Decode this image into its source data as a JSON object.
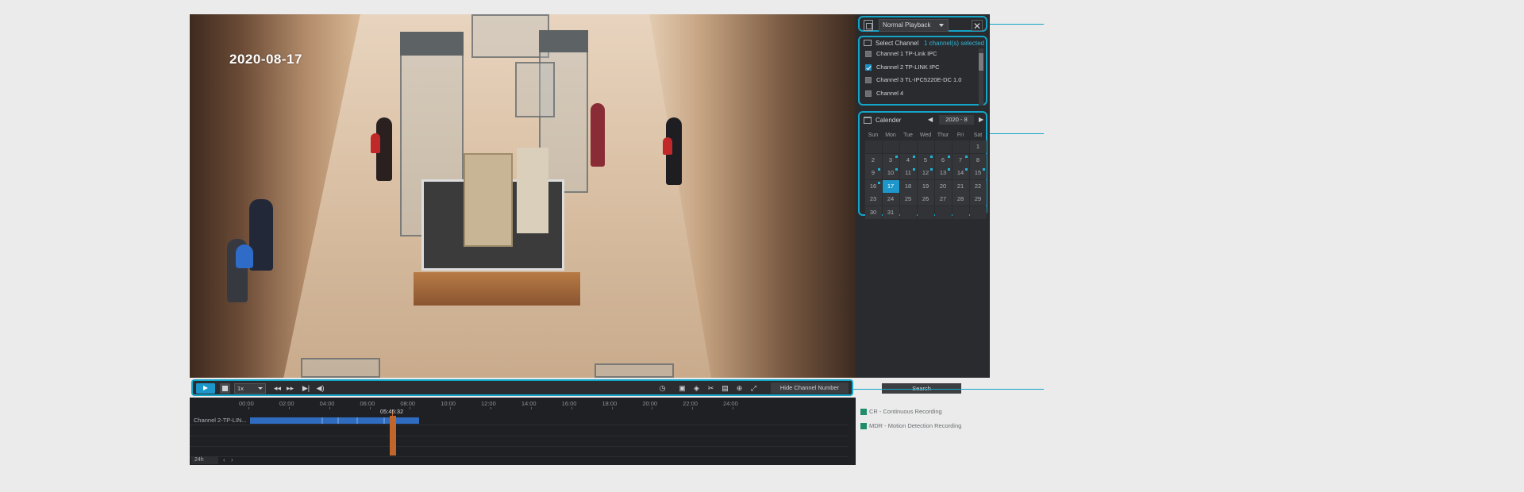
{
  "video": {
    "timestamp": "2020-08-17"
  },
  "panel": {
    "playback_mode": "Normal Playback",
    "close_glyph": "✕",
    "channels": {
      "title": "Select Channel",
      "count": "1 channel(s) selected",
      "items": [
        {
          "label": "Channel 1 TP-Link IPC",
          "checked": false
        },
        {
          "label": "Channel 2 TP-LINK IPC",
          "checked": true
        },
        {
          "label": "Channel 3 TL-IPC5220E-DC 1.0",
          "checked": false
        },
        {
          "label": "Channel 4",
          "checked": false
        }
      ]
    },
    "calendar": {
      "title": "Calender",
      "month": "2020 - 8",
      "prev": "◀",
      "next": "▶",
      "weekdays": [
        "Sun",
        "Mon",
        "Tue",
        "Wed",
        "Thur",
        "Fri",
        "Sat"
      ],
      "today": 17,
      "recorded_days": [
        3,
        4,
        5,
        6,
        7,
        9,
        10,
        11,
        12,
        13,
        14,
        15,
        16
      ],
      "weeks": [
        [
          "",
          "",
          "",
          "",
          "",
          "",
          "1"
        ],
        [
          "2",
          "3",
          "4",
          "5",
          "6",
          "7",
          "8"
        ],
        [
          "9",
          "10",
          "11",
          "12",
          "13",
          "14",
          "15"
        ],
        [
          "16",
          "17",
          "18",
          "19",
          "20",
          "21",
          "22"
        ],
        [
          "23",
          "24",
          "25",
          "26",
          "27",
          "28",
          "29"
        ],
        [
          "30",
          "31",
          "",
          "",
          "",
          "",
          ""
        ]
      ]
    },
    "search_label": "Search",
    "legend": [
      {
        "label": "CR - Continuous Recording"
      },
      {
        "label": "MDR - Motion Detection Recording"
      }
    ]
  },
  "toolbar": {
    "speed": "1x",
    "hide_channel_label": "Hide Channel Number"
  },
  "timeline": {
    "ticks": [
      "00:00",
      "02:00",
      "04:00",
      "06:00",
      "08:00",
      "10:00",
      "12:00",
      "14:00",
      "16:00",
      "18:00",
      "20:00",
      "22:00",
      "24:00"
    ],
    "row_label": "Channel 2-TP-LIN...",
    "cursor_time": "05:45:32",
    "zoom": "24h",
    "prev": "‹",
    "next": "›"
  },
  "colors": {
    "accent": "#13a5c8",
    "panel_bg": "#2a2b2e",
    "recording_bar": "#2f6cc0",
    "cursor": "#c0662a"
  }
}
